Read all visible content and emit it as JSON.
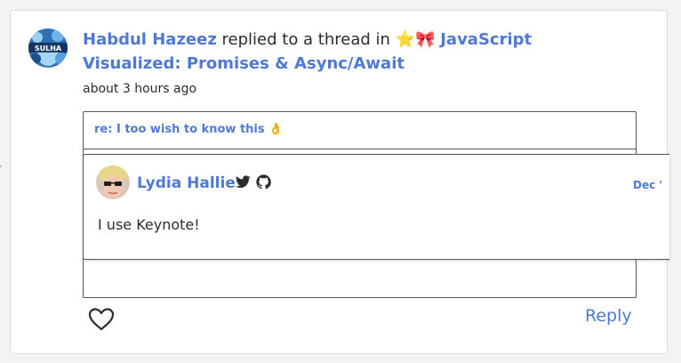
{
  "activity": {
    "user_name": "Habdul Hazeez",
    "action_text": " replied to a thread in ",
    "emojis": "⭐🎀",
    "thread_title": "JavaScript Visualized: Promises & Async/Await",
    "time_ago": "about 3 hours ago",
    "avatar_icon": "user-avatar-icon",
    "avatar_text": "SULHA"
  },
  "thread": {
    "reply_title": "re: I too wish to know this",
    "reply_emoji": "👌"
  },
  "comment": {
    "author": "Lydia Hallie",
    "date": "Dec '",
    "body": "I use Keynote!",
    "social_icons": [
      "twitter-icon",
      "github-icon"
    ]
  },
  "actions": {
    "like_icon": "heart-icon",
    "reply_label": "Reply"
  },
  "colors": {
    "link": "#4e79d4",
    "text": "#2b2b2b",
    "border": "#555555"
  }
}
